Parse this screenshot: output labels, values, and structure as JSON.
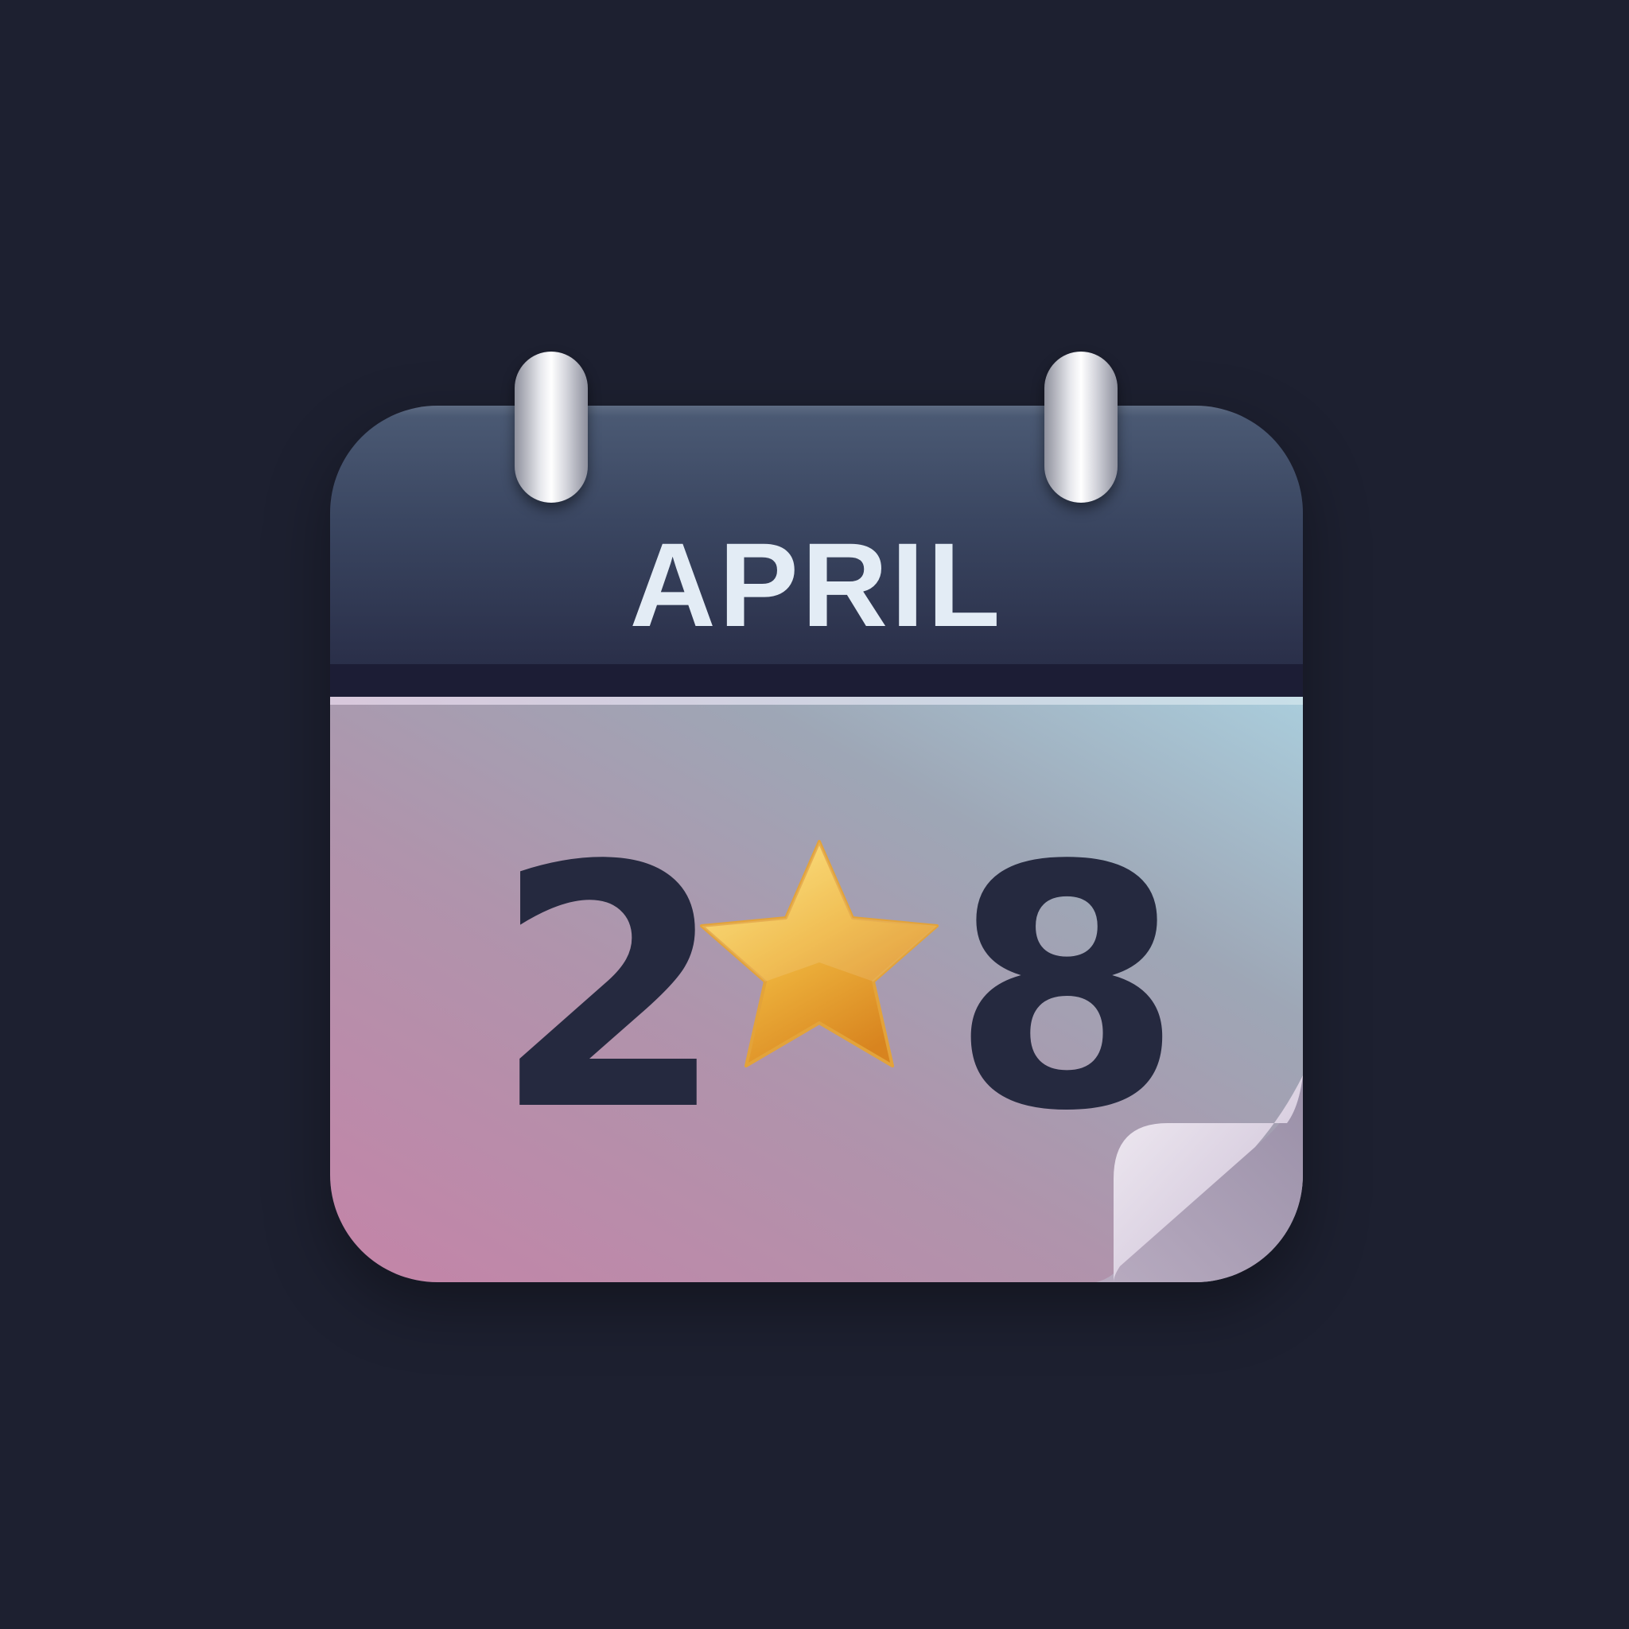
{
  "calendar": {
    "month": "APRIL",
    "day_first_digit": "2",
    "day_second_digit": "8",
    "marker_icon": "star-icon"
  },
  "colors": {
    "background": "#1d2030",
    "header": "#3a4661",
    "page_pink": "#c484a8",
    "page_blue": "#aacddc",
    "digits": "#25293f",
    "star": "#f2b93b"
  }
}
